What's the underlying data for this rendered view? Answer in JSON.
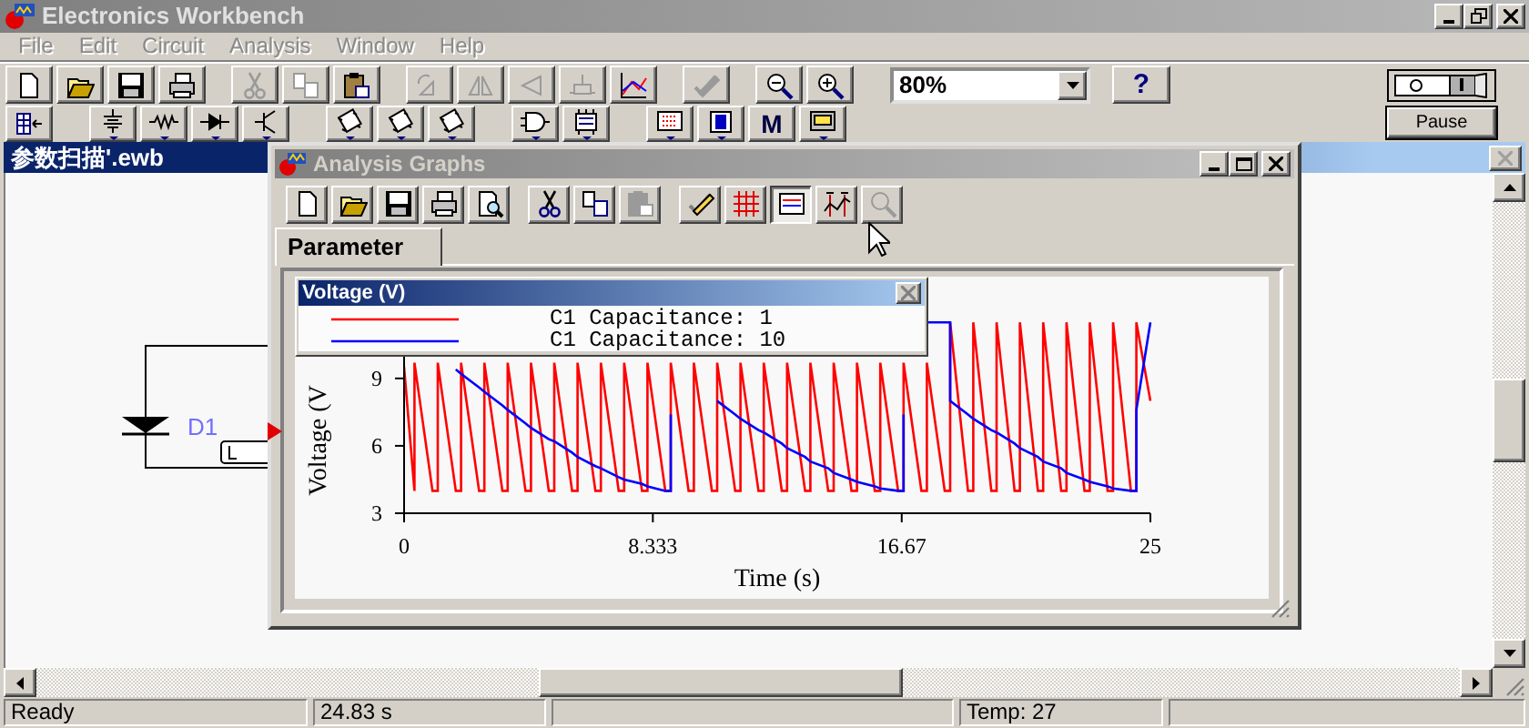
{
  "window": {
    "title": "Electronics Workbench"
  },
  "menu": [
    {
      "label": "File",
      "disabled": true
    },
    {
      "label": "Edit",
      "disabled": true
    },
    {
      "label": "Circuit",
      "disabled": true
    },
    {
      "label": "Analysis",
      "disabled": true
    },
    {
      "label": "Window",
      "disabled": true
    },
    {
      "label": "Help",
      "disabled": true
    }
  ],
  "toolbar": {
    "groups": [
      [
        {
          "kind": "new-file",
          "disabled": false
        },
        {
          "kind": "open",
          "disabled": false
        },
        {
          "kind": "save",
          "disabled": false
        },
        {
          "kind": "print",
          "disabled": false
        }
      ],
      [
        {
          "kind": "cut",
          "disabled": true
        },
        {
          "kind": "copy",
          "disabled": true
        },
        {
          "kind": "paste",
          "disabled": false
        }
      ],
      [
        {
          "kind": "rotate",
          "disabled": true
        },
        {
          "kind": "flip-horizontal",
          "disabled": true
        },
        {
          "kind": "flip-vertical",
          "disabled": true
        },
        {
          "kind": "properties",
          "disabled": true
        },
        {
          "kind": "graph",
          "disabled": false
        }
      ],
      [
        {
          "kind": "edit",
          "disabled": true
        }
      ],
      [
        {
          "kind": "zoom-out",
          "disabled": false
        },
        {
          "kind": "zoom-in",
          "disabled": false
        }
      ]
    ],
    "zoom": "80%",
    "help": "?"
  },
  "parts_toolbar": {
    "groups": [
      [
        {
          "kind": "bins"
        }
      ],
      [
        {
          "kind": "sources"
        },
        {
          "kind": "resistor"
        },
        {
          "kind": "diode"
        },
        {
          "kind": "transistor"
        }
      ],
      [
        {
          "kind": "chip"
        },
        {
          "kind": "chip"
        },
        {
          "kind": "chip"
        }
      ],
      [
        {
          "kind": "gate"
        },
        {
          "kind": "flip-flop"
        }
      ],
      [
        {
          "kind": "display"
        },
        {
          "kind": "function"
        },
        {
          "kind": "text",
          "label": "M"
        },
        {
          "kind": "instrument"
        }
      ]
    ]
  },
  "simulation": {
    "power_on": true,
    "pause": "Pause"
  },
  "document": {
    "title": "参数扫描'.ewb",
    "part_label": "D1"
  },
  "analysis": {
    "title": "Analysis Graphs",
    "tools": [
      [
        {
          "kind": "new-file",
          "disabled": false,
          "pressed": false
        },
        {
          "kind": "open",
          "disabled": false,
          "pressed": false
        },
        {
          "kind": "save",
          "disabled": false,
          "pressed": false
        },
        {
          "kind": "print",
          "disabled": false,
          "pressed": false
        },
        {
          "kind": "preview",
          "disabled": false,
          "pressed": false
        }
      ],
      [
        {
          "kind": "cut",
          "disabled": false,
          "pressed": false
        },
        {
          "kind": "copy",
          "disabled": false,
          "pressed": false
        },
        {
          "kind": "paste",
          "disabled": true,
          "pressed": false
        }
      ],
      [
        {
          "kind": "edit",
          "disabled": false,
          "pressed": false
        },
        {
          "kind": "grid",
          "disabled": false,
          "pressed": false
        },
        {
          "kind": "legend",
          "disabled": false,
          "pressed": true
        },
        {
          "kind": "cursors",
          "disabled": false,
          "pressed": false
        },
        {
          "kind": "zoom",
          "disabled": true,
          "pressed": false
        }
      ]
    ],
    "tabs": [
      {
        "label": "Parameter",
        "selected": true
      }
    ],
    "legend": {
      "title": "Voltage (V)"
    },
    "chart_data": {
      "type": "line",
      "xlabel": "Time (s)",
      "ylabel": "Voltage (V",
      "xlim": [
        0,
        25
      ],
      "ylim": [
        3,
        12.8
      ],
      "xticks": [
        0,
        8.333,
        16.67,
        25
      ],
      "yticks": [
        3,
        6,
        9
      ],
      "x": [
        0,
        0.35,
        0.35,
        0.95,
        1.13,
        1.13,
        1.73,
        1.91,
        1.91,
        2.51,
        2.69,
        2.69,
        3.29,
        3.47,
        3.47,
        4.07,
        4.25,
        4.25,
        4.85,
        5.03,
        5.03,
        5.63,
        5.81,
        5.81,
        6.41,
        6.59,
        6.59,
        7.19,
        7.37,
        7.37,
        7.97,
        8.15,
        8.15,
        8.75,
        8.93,
        8.93,
        9.53,
        9.71,
        9.71,
        10.31,
        10.49,
        10.49,
        11.09,
        11.27,
        11.27,
        11.87,
        12.05,
        12.05,
        12.65,
        12.83,
        12.83,
        13.43,
        13.61,
        13.61,
        14.21,
        14.39,
        14.39,
        14.99,
        15.17,
        15.17,
        15.77,
        15.95,
        15.95,
        16.55,
        16.73,
        16.73,
        17.33,
        17.51,
        17.51,
        18.11,
        18.29,
        18.29,
        18.89,
        19.07,
        19.07,
        19.67,
        19.85,
        19.85,
        20.45,
        20.63,
        20.63,
        21.23,
        21.41,
        21.41,
        22.01,
        22.19,
        22.19,
        22.79,
        22.97,
        22.97,
        23.57,
        23.75,
        23.75,
        24.35,
        24.53,
        24.53,
        25
      ],
      "series": [
        {
          "name": "C1 Capacitance: 1",
          "color": "#ff0000",
          "values": [
            9.5,
            4,
            9.7,
            4,
            4,
            9.7,
            4,
            4,
            9.7,
            4,
            4,
            9.7,
            4,
            4,
            9.7,
            4,
            4,
            9.7,
            4,
            4,
            9.7,
            4,
            4,
            9.7,
            4,
            4,
            9.7,
            4,
            4,
            9.7,
            4,
            4,
            9.7,
            4,
            4,
            9.7,
            4,
            4,
            9.7,
            4,
            4,
            9.7,
            4,
            4,
            9.7,
            4,
            4,
            9.7,
            4,
            4,
            9.7,
            4,
            4,
            9.7,
            4,
            4,
            9.7,
            4,
            4,
            9.7,
            4,
            4,
            9.7,
            4,
            4,
            9.7,
            4,
            4,
            9.7,
            4,
            4,
            11.5,
            4,
            4,
            11.5,
            4,
            4,
            11.5,
            4,
            4,
            11.5,
            4,
            4,
            11.5,
            4,
            4,
            11.5,
            4,
            4,
            11.5,
            4,
            4,
            11.5,
            4,
            4,
            11.5,
            8
          ]
        },
        {
          "name": "C1 Capacitance: 10",
          "color": "#0000ff",
          "values": [
            null,
            null,
            null,
            null,
            null,
            null,
            9.4,
            9.2,
            9.2,
            8.6,
            8.4,
            8.4,
            7.8,
            7.6,
            7.6,
            7,
            6.8,
            6.8,
            6.3,
            6.2,
            6.2,
            5.7,
            5.5,
            5.5,
            5.1,
            5,
            5,
            4.6,
            4.5,
            4.5,
            4.3,
            4.2,
            4.2,
            4,
            4,
            7.4,
            null,
            null,
            null,
            null,
            null,
            8,
            7.4,
            7.2,
            7.2,
            6.7,
            6.6,
            6.6,
            6.1,
            5.9,
            5.9,
            5.5,
            5.3,
            5.3,
            5,
            4.8,
            4.8,
            4.5,
            4.4,
            4.4,
            4.2,
            4.1,
            4.1,
            4,
            4,
            7.4,
            null,
            11.5,
            11.5,
            11.5,
            11.5,
            8,
            7.4,
            7.2,
            7.2,
            6.7,
            6.6,
            6.6,
            6.1,
            5.9,
            5.9,
            5.5,
            5.3,
            5.3,
            5,
            4.8,
            4.8,
            4.5,
            4.4,
            4.4,
            4.2,
            4.1,
            4.1,
            4,
            4,
            7.6,
            11.5
          ]
        }
      ]
    }
  },
  "status_bar": [
    "Ready",
    "24.83 s",
    "Temp: 27"
  ]
}
